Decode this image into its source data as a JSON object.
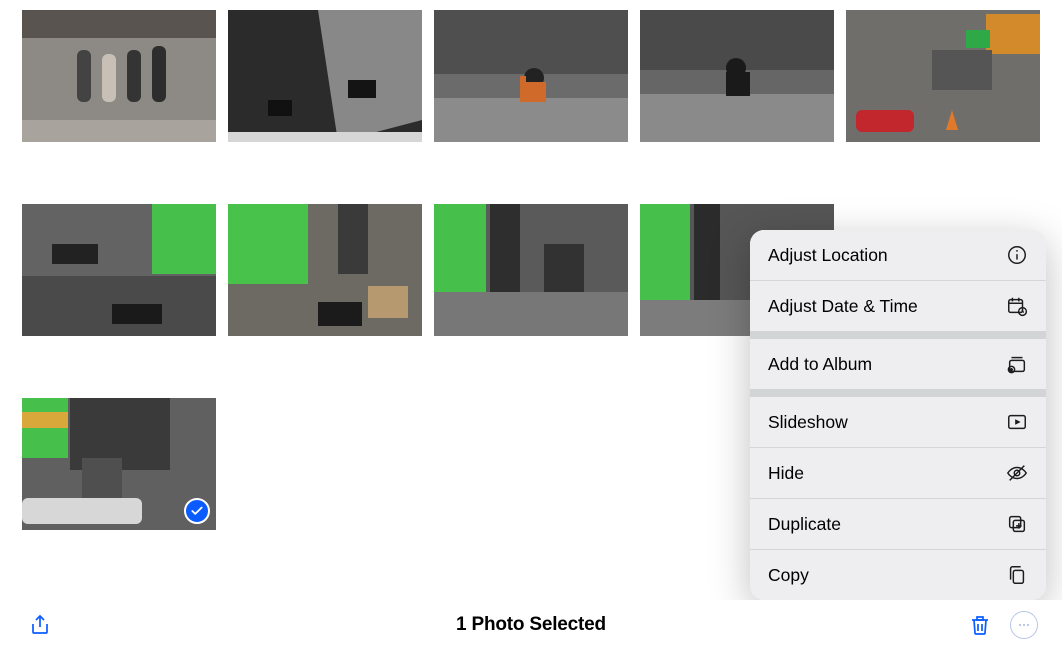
{
  "toolbar": {
    "status_text": "1 Photo Selected"
  },
  "thumbnails": {
    "count": 11,
    "selected_index": 10
  },
  "popover": {
    "adjust_location": "Adjust Location",
    "adjust_datetime": "Adjust Date & Time",
    "add_to_album": "Add to Album",
    "slideshow": "Slideshow",
    "hide": "Hide",
    "duplicate": "Duplicate",
    "copy": "Copy"
  },
  "colors": {
    "accent": "#0a5cff"
  }
}
